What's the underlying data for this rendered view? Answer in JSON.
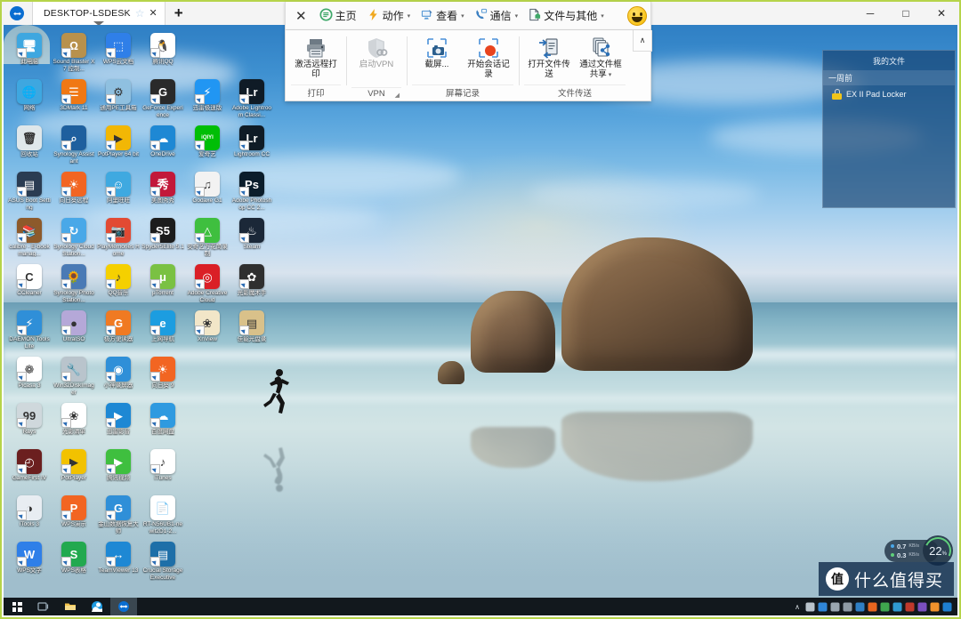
{
  "window": {
    "tab_title": "DESKTOP-LSDESK",
    "new_tab_label": "+",
    "star_glyph": "☆",
    "close_glyph": "✕",
    "minimize_glyph": "─",
    "maximize_glyph": "□",
    "window_close_glyph": "✕",
    "logo_name": "teamviewer-logo"
  },
  "toolbar": {
    "close_glyph": "✕",
    "collapse_glyph": "∧",
    "menus": [
      {
        "label": "主页",
        "icon": "home-icon",
        "caret": false
      },
      {
        "label": "动作",
        "icon": "actions-lightning-icon",
        "caret": true
      },
      {
        "label": "查看",
        "icon": "view-monitor-icon",
        "caret": true
      },
      {
        "label": "通信",
        "icon": "communicate-phone-icon",
        "caret": true
      },
      {
        "label": "文件与其他",
        "icon": "files-extras-icon",
        "caret": true
      }
    ],
    "smiley_label": "笑脸",
    "groups": [
      {
        "title": "打印",
        "dialog_launcher": false,
        "items": [
          {
            "label": "激活远程打印",
            "icon": "printer-icon",
            "disabled": false,
            "dropdown": false
          }
        ]
      },
      {
        "title": "VPN",
        "dialog_launcher": true,
        "items": [
          {
            "label": "启动VPN",
            "icon": "vpn-shield-icon",
            "disabled": true,
            "dropdown": false
          }
        ]
      },
      {
        "title": "屏幕记录",
        "dialog_launcher": false,
        "items": [
          {
            "label": "截屏...",
            "icon": "screenshot-camera-icon",
            "disabled": false,
            "dropdown": false
          },
          {
            "label": "开始会话记录",
            "icon": "record-session-icon",
            "disabled": false,
            "dropdown": false
          }
        ]
      },
      {
        "title": "文件传送",
        "dialog_launcher": false,
        "items": [
          {
            "label": "打开文件传送",
            "icon": "file-transfer-icon",
            "disabled": false,
            "dropdown": false
          },
          {
            "label": "通过文件框共享",
            "icon": "file-share-icon",
            "disabled": false,
            "dropdown": true
          }
        ]
      }
    ]
  },
  "files_panel": {
    "title": "我的文件",
    "group_label": "一周前",
    "items": [
      {
        "name": "EX II Pad Locker",
        "icon": "lock-icon"
      }
    ]
  },
  "perf_widget": {
    "upload_value": "0.7",
    "upload_unit": "KB/s",
    "download_value": "0.3",
    "download_unit": "KB/s",
    "cpu_percent": "22",
    "percent_symbol": "%"
  },
  "watermark": {
    "badge": "值",
    "text": "什么值得买"
  },
  "taskbar": {
    "start_name": "start-button",
    "buttons": [
      {
        "name": "task-view-button",
        "icon": "task-view-icon",
        "color": "#9fb0bd",
        "active": false
      },
      {
        "name": "file-explorer-button",
        "icon": "folder-icon",
        "color": "#f2c24b",
        "active": false
      },
      {
        "name": "browser-button",
        "icon": "browser-icon",
        "color": "#1e9ae0",
        "active": false
      },
      {
        "name": "teamviewer-button",
        "icon": "teamviewer-icon",
        "color": "#0a6ed1",
        "active": true
      }
    ],
    "tray_chevron": "∧",
    "tray_icons": [
      {
        "name": "tray-nvidia-icon",
        "color": "#b9c3cb"
      },
      {
        "name": "tray-security-icon",
        "color": "#2f86d8"
      },
      {
        "name": "tray-mouse-icon",
        "color": "#9aa6b0"
      },
      {
        "name": "tray-link-icon",
        "color": "#8e9aa4"
      },
      {
        "name": "tray-cloud-icon",
        "color": "#2f7fc4"
      },
      {
        "name": "tray-flame-icon",
        "color": "#e8661f"
      },
      {
        "name": "tray-leaf-icon",
        "color": "#3fa64e"
      },
      {
        "name": "tray-moon-icon",
        "color": "#2f9ad0"
      },
      {
        "name": "tray-book-icon",
        "color": "#c0392b"
      },
      {
        "name": "tray-palette-icon",
        "color": "#7b4fbf"
      },
      {
        "name": "tray-orange-icon",
        "color": "#f0922c"
      },
      {
        "name": "tray-windows-icon",
        "color": "#1e7fd0"
      }
    ]
  },
  "desktop": {
    "icons": [
      {
        "label": "此电脑",
        "icon": "this-pc-icon",
        "color": "#3ea7e0",
        "glyph": "🖥",
        "shortcut": true
      },
      {
        "label": "Sound Blaster X7 控制...",
        "icon": "sound-blaster-icon",
        "color": "#b8914c",
        "glyph": "Ω",
        "shortcut": true
      },
      {
        "label": "WPS云文档",
        "icon": "wps-cloud-icon",
        "color": "#2f7fe8",
        "glyph": "⬚",
        "shortcut": true
      },
      {
        "label": "腾讯QQ",
        "icon": "qq-icon",
        "color": "#ffffff",
        "glyph": "🐧",
        "shortcut": true
      },
      {
        "label": "",
        "icon": "",
        "color": "",
        "glyph": "",
        "shortcut": false
      },
      {
        "label": "",
        "icon": "",
        "color": "",
        "glyph": "",
        "shortcut": false
      },
      {
        "label": "网络",
        "icon": "network-icon",
        "color": "#3ea7e0",
        "glyph": "🌐",
        "shortcut": false
      },
      {
        "label": "3DMark 11",
        "icon": "3dmark-icon",
        "color": "#f07814",
        "glyph": "☰",
        "shortcut": true
      },
      {
        "label": "通用PE工具箱",
        "icon": "pe-toolbox-icon",
        "color": "#8fc0e0",
        "glyph": "⚙",
        "shortcut": true
      },
      {
        "label": "GeForce Experience",
        "icon": "geforce-experience-icon",
        "color": "#2a2a2a",
        "glyph": "G",
        "shortcut": true
      },
      {
        "label": "迅雷极速版",
        "icon": "thunder-icon",
        "color": "#2196f3",
        "glyph": "⚡",
        "shortcut": true
      },
      {
        "label": "Adobe Lightroom Classi...",
        "icon": "lightroom-classic-icon",
        "color": "#0f1b26",
        "glyph": "Lr",
        "shortcut": true
      },
      {
        "label": "回收站",
        "icon": "recycle-bin-icon",
        "color": "#dfe7ea",
        "glyph": "🗑",
        "shortcut": false
      },
      {
        "label": "Synology Assistant",
        "icon": "synology-assistant-icon",
        "color": "#1e5f9e",
        "glyph": "⌕",
        "shortcut": true
      },
      {
        "label": "PotPlayer 64 bit",
        "icon": "potplayer-icon",
        "color": "#f2b705",
        "glyph": "▶",
        "shortcut": true
      },
      {
        "label": "OneDrive",
        "icon": "onedrive-icon",
        "color": "#1e88d4",
        "glyph": "☁",
        "shortcut": true
      },
      {
        "label": "爱奇艺",
        "icon": "iqiyi-icon",
        "color": "#00be06",
        "glyph": "iQIYI",
        "shortcut": true
      },
      {
        "label": "Lightroom CC",
        "icon": "lightroom-cc-icon",
        "color": "#0f1b26",
        "glyph": "Lr",
        "shortcut": true
      },
      {
        "label": "ASUS Boot Setting",
        "icon": "asus-boot-setting-icon",
        "color": "#2a3c52",
        "glyph": "▤",
        "shortcut": true
      },
      {
        "label": "向日葵远程",
        "icon": "sunflower-remote-icon",
        "color": "#f26522",
        "glyph": "☀",
        "shortcut": true
      },
      {
        "label": "阿里旺旺",
        "icon": "aliwangwang-icon",
        "color": "#3fa9e0",
        "glyph": "☺",
        "shortcut": true
      },
      {
        "label": "美图秀秀",
        "icon": "meitu-icon",
        "color": "#c2183a",
        "glyph": "秀",
        "shortcut": true
      },
      {
        "label": "Godaxe G1",
        "icon": "godaxe-icon",
        "color": "#f2f2f2",
        "glyph": "♫",
        "shortcut": true
      },
      {
        "label": "Adobe Photoshop CC 2...",
        "icon": "photoshop-icon",
        "color": "#0b1d2b",
        "glyph": "Ps",
        "shortcut": true
      },
      {
        "label": "calibre - E-book manag...",
        "icon": "calibre-icon",
        "color": "#8d5a2b",
        "glyph": "📚",
        "shortcut": true
      },
      {
        "label": "Synology Cloud Station...",
        "icon": "synology-cloud-station-icon",
        "color": "#49a8e8",
        "glyph": "↻",
        "shortcut": true
      },
      {
        "label": "PlayMemories Home",
        "icon": "playmemories-icon",
        "color": "#e24a33",
        "glyph": "📷",
        "shortcut": true
      },
      {
        "label": "Spyder5Elite 5.1",
        "icon": "spyder5elite-icon",
        "color": "#1c1c1c",
        "glyph": "S5",
        "shortcut": true
      },
      {
        "label": "安奇艺万花筒录制",
        "icon": "kaleidoscope-icon",
        "color": "#3fbf3f",
        "glyph": "△",
        "shortcut": true
      },
      {
        "label": "Steam",
        "icon": "steam-icon",
        "color": "#1b2838",
        "glyph": "♨",
        "shortcut": true
      },
      {
        "label": "CCleaner",
        "icon": "ccleaner-icon",
        "color": "#ffffff",
        "glyph": "C",
        "shortcut": true
      },
      {
        "label": "Synology Photo Station...",
        "icon": "synology-photo-station-icon",
        "color": "#4a7ab5",
        "glyph": "🌻",
        "shortcut": true
      },
      {
        "label": "QQ音乐",
        "icon": "qq-music-icon",
        "color": "#f5d000",
        "glyph": "♪",
        "shortcut": true
      },
      {
        "label": "μTorrent",
        "icon": "utorrent-icon",
        "color": "#7ac143",
        "glyph": "μ",
        "shortcut": true
      },
      {
        "label": "Adobe Creative Cloud",
        "icon": "adobe-creative-cloud-icon",
        "color": "#da1f26",
        "glyph": "◎",
        "shortcut": true
      },
      {
        "label": "光影魔术手",
        "icon": "photo-magic-icon",
        "color": "#2f2f2f",
        "glyph": "✿",
        "shortcut": true
      },
      {
        "label": "DAEMON Tools Lite",
        "icon": "daemon-tools-icon",
        "color": "#2f8fd8",
        "glyph": "⚡",
        "shortcut": true
      },
      {
        "label": "UltraISO",
        "icon": "ultraiso-icon",
        "color": "#b5a8d8",
        "glyph": "●",
        "shortcut": true
      },
      {
        "label": "极方便读器",
        "icon": "pdf-reader-icon",
        "color": "#f07a22",
        "glyph": "G",
        "shortcut": true
      },
      {
        "label": "上网导航",
        "icon": "internet-explorer-icon",
        "color": "#1c9de0",
        "glyph": "e",
        "shortcut": true
      },
      {
        "label": "XnView",
        "icon": "xnview-icon",
        "color": "#f2e6c8",
        "glyph": "❀",
        "shortcut": true
      },
      {
        "label": "佳能光盘录",
        "icon": "disc-burner-icon",
        "color": "#d9c18a",
        "glyph": "▤",
        "shortcut": true
      },
      {
        "label": "Picasa 3",
        "icon": "picasa-icon",
        "color": "#ffffff",
        "glyph": "❁",
        "shortcut": true
      },
      {
        "label": "Win32DiskImager",
        "icon": "win32diskimager-icon",
        "color": "#b9c4cc",
        "glyph": "🔧",
        "shortcut": true
      },
      {
        "label": "小神录屏器",
        "icon": "screen-recorder-icon",
        "color": "#2f8fd8",
        "glyph": "◉",
        "shortcut": true
      },
      {
        "label": "向日葵 9",
        "icon": "sunflower9-icon",
        "color": "#f26522",
        "glyph": "☀",
        "shortcut": true
      },
      {
        "label": "",
        "icon": "",
        "color": "",
        "glyph": "",
        "shortcut": false
      },
      {
        "label": "",
        "icon": "",
        "color": "",
        "glyph": "",
        "shortcut": false
      },
      {
        "label": "Rays",
        "icon": "rays-icon",
        "color": "#cfd8dc",
        "glyph": "99",
        "shortcut": true
      },
      {
        "label": "光影清单",
        "icon": "photo-list-icon",
        "color": "#ffffff",
        "glyph": "❀",
        "shortcut": true
      },
      {
        "label": "迅雷影音",
        "icon": "thunder-video-icon",
        "color": "#1e88d4",
        "glyph": "▶",
        "shortcut": true
      },
      {
        "label": "百度网盘",
        "icon": "baidu-netdisk-icon",
        "color": "#2f9ae0",
        "glyph": "☁",
        "shortcut": true
      },
      {
        "label": "",
        "icon": "",
        "color": "",
        "glyph": "",
        "shortcut": false
      },
      {
        "label": "",
        "icon": "",
        "color": "",
        "glyph": "",
        "shortcut": false
      },
      {
        "label": "GameFirst IV",
        "icon": "gamefirst-icon",
        "color": "#6b1f1f",
        "glyph": "◴",
        "shortcut": true
      },
      {
        "label": "PotPlayer",
        "icon": "potplayer2-icon",
        "color": "#f2c200",
        "glyph": "▶",
        "shortcut": true
      },
      {
        "label": "腾讯视频",
        "icon": "tencent-video-icon",
        "color": "#3fbf3f",
        "glyph": "▶",
        "shortcut": true
      },
      {
        "label": "iTunes",
        "icon": "itunes-icon",
        "color": "#ffffff",
        "glyph": "♪",
        "shortcut": true
      },
      {
        "label": "",
        "icon": "",
        "color": "",
        "glyph": "",
        "shortcut": false
      },
      {
        "label": "",
        "icon": "",
        "color": "",
        "glyph": "",
        "shortcut": false
      },
      {
        "label": "iTools 3",
        "icon": "itools-icon",
        "color": "#e8edf2",
        "glyph": "◑",
        "shortcut": true
      },
      {
        "label": "WPS演示",
        "icon": "wps-presentation-icon",
        "color": "#f26522",
        "glyph": "P",
        "shortcut": true
      },
      {
        "label": "金山数据恢复大师",
        "icon": "data-recovery-icon",
        "color": "#2f8fd8",
        "glyph": "G",
        "shortcut": true
      },
      {
        "label": "RT-N56UB1-newit2D1-2...",
        "icon": "text-file-icon",
        "color": "#ffffff",
        "glyph": "📄",
        "shortcut": false
      },
      {
        "label": "",
        "icon": "",
        "color": "",
        "glyph": "",
        "shortcut": false
      },
      {
        "label": "",
        "icon": "",
        "color": "",
        "glyph": "",
        "shortcut": false
      },
      {
        "label": "WPS文字",
        "icon": "wps-writer-icon",
        "color": "#2f7fe8",
        "glyph": "W",
        "shortcut": true
      },
      {
        "label": "WPS表格",
        "icon": "wps-spreadsheet-icon",
        "color": "#22a94f",
        "glyph": "S",
        "shortcut": true
      },
      {
        "label": "TeamViewer 13",
        "icon": "teamviewer13-icon",
        "color": "#1e88d4",
        "glyph": "↔",
        "shortcut": true
      },
      {
        "label": "Crucial Storage Executive",
        "icon": "crucial-storage-icon",
        "color": "#1e6fa8",
        "glyph": "▤",
        "shortcut": true
      },
      {
        "label": "",
        "icon": "",
        "color": "",
        "glyph": "",
        "shortcut": false
      },
      {
        "label": "",
        "icon": "",
        "color": "",
        "glyph": "",
        "shortcut": false
      }
    ]
  }
}
